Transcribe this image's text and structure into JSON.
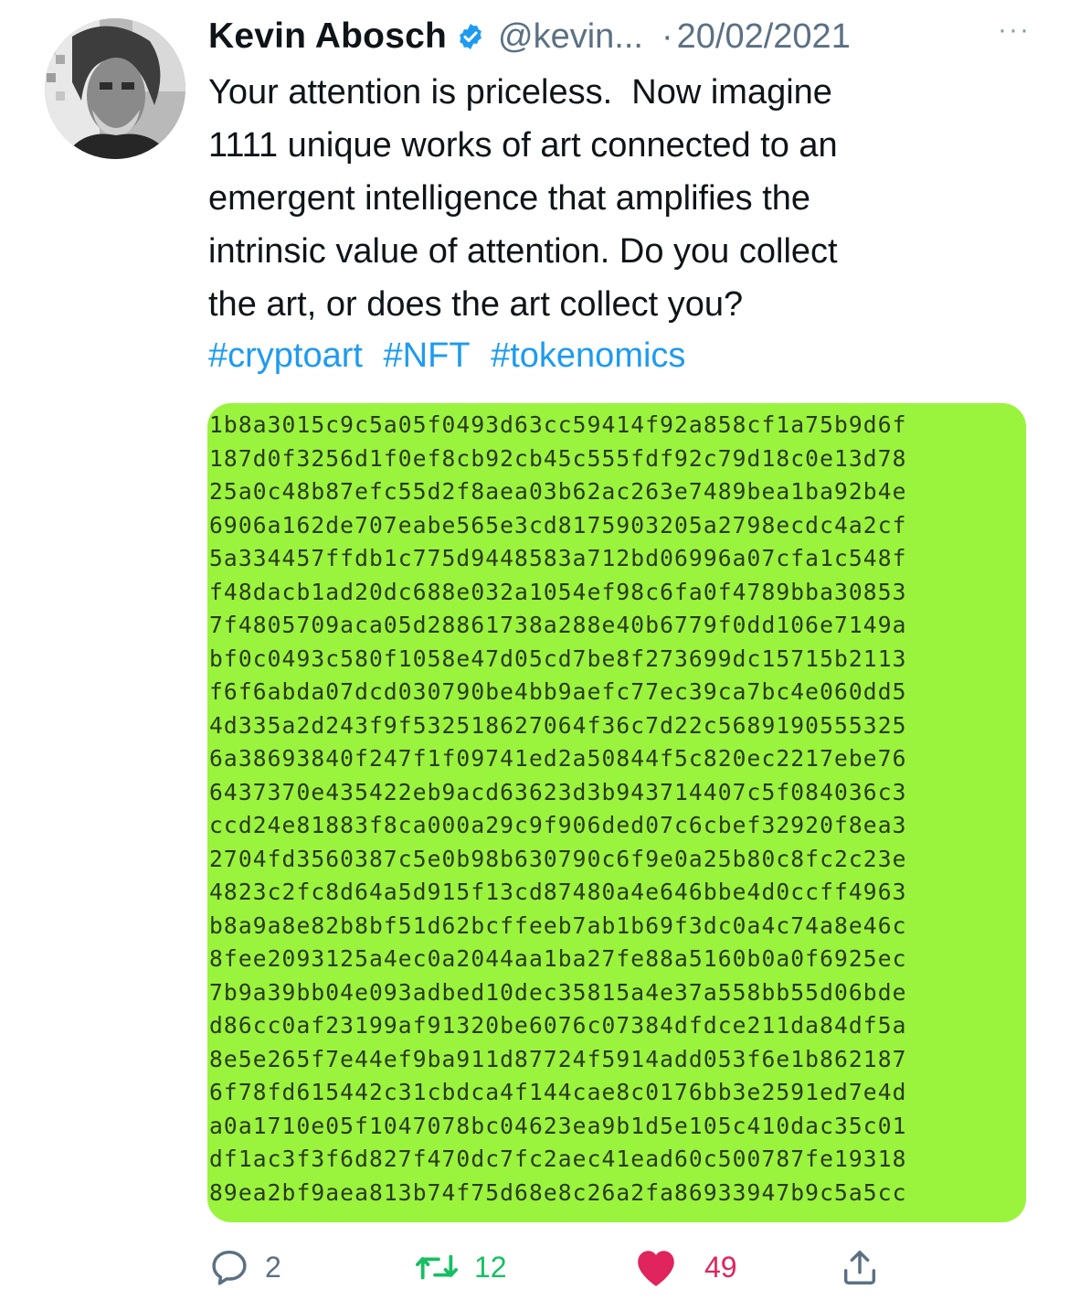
{
  "author": {
    "name": "Kevin Abosch",
    "handle": "@kevin...",
    "separator": "·",
    "date": "20/02/2021",
    "more_label": "···"
  },
  "tweet": {
    "lines": [
      "Your attention is priceless.  Now imagine",
      "1111 unique works of art connected to an",
      "emergent intelligence that amplifies the",
      "intrinsic value of attention. Do you collect",
      "the art, or does the art collect you?"
    ],
    "hashtags": [
      "#cryptoart",
      "#NFT",
      "#tokenomics"
    ]
  },
  "media": {
    "background_color": "#9af33d",
    "hex_lines": [
      "1b8a3015c9c5a05f0493d63cc59414f92a858cf1a75b9d6f",
      "187d0f3256d1f0ef8cb92cb45c555fdf92c79d18c0e13d78",
      "25a0c48b87efc55d2f8aea03b62ac263e7489bea1ba92b4e",
      "6906a162de707eabe565e3cd8175903205a2798ecdc4a2cf",
      "5a334457ffdb1c775d9448583a712bd06996a07cfa1c548f",
      "f48dacb1ad20dc688e032a1054ef98c6fa0f4789bba30853",
      "7f4805709aca05d28861738a288e40b6779f0dd106e7149a",
      "bf0c0493c580f1058e47d05cd7be8f273699dc15715b2113",
      "f6f6abda07dcd030790be4bb9aefc77ec39ca7bc4e060dd5",
      "4d335a2d243f9f532518627064f36c7d22c5689190555325",
      "6a38693840f247f1f09741ed2a50844f5c820ec2217ebe76",
      "6437370e435422eb9acd63623d3b943714407c5f084036c3",
      "ccd24e81883f8ca000a29c9f906ded07c6cbef32920f8ea3",
      "2704fd3560387c5e0b98b630790c6f9e0a25b80c8fc2c23e",
      "4823c2fc8d64a5d915f13cd87480a4e646bbe4d0ccff4963",
      "b8a9a8e82b8bf51d62bcffeeb7ab1b69f3dc0a4c74a8e46c",
      "8fee2093125a4ec0a2044aa1ba27fe88a5160b0a0f6925ec",
      "7b9a39bb04e093adbed10dec35815a4e37a558bb55d06bde",
      "d86cc0af23199af91320be6076c07384dfdce211da84df5a",
      "8e5e265f7e44ef9ba911d87724f5914add053f6e1b862187",
      "6f78fd615442c31cbdca4f144cae8c0176bb3e2591ed7e4d",
      "a0a1710e05f1047078bc04623ea9b1d5e105c410dac35c01",
      "df1ac3f3f6d827f470dc7fc2aec41ead60c500787fe19318",
      "89ea2bf9aea813b74f75d68e8c26a2fa86933947b9c5a5cc"
    ]
  },
  "actions": {
    "replies": "2",
    "retweets": "12",
    "likes": "49",
    "reply_color": "#5b7083",
    "retweet_color": "#17bf63",
    "like_color": "#e0245e",
    "icons": [
      "reply-icon",
      "retweet-icon",
      "heart-icon",
      "share-icon"
    ]
  }
}
